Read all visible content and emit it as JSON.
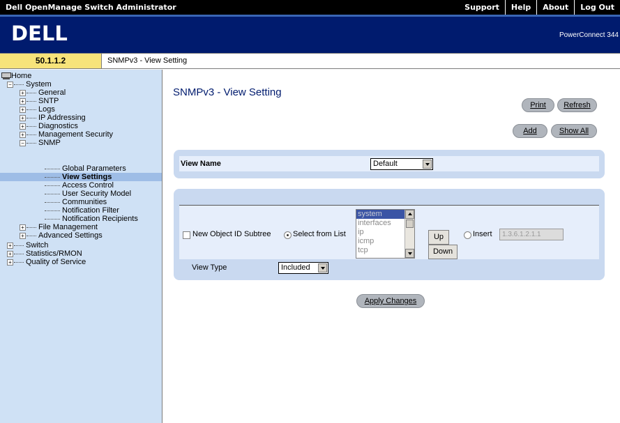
{
  "topbar": {
    "app_title": "Dell OpenManage Switch Administrator",
    "links": [
      "Support",
      "Help",
      "About",
      "Log Out"
    ]
  },
  "banner": {
    "logo_text": "DELL",
    "product": "PowerConnect 344"
  },
  "address": {
    "ip": "50.1.1.2",
    "breadcrumb": "SNMPv3 - View Setting"
  },
  "tree": {
    "home": "Home",
    "system": "System",
    "general": "General",
    "sntp": "SNTP",
    "logs": "Logs",
    "ip_addressing": "IP Addressing",
    "diagnostics": "Diagnostics",
    "mgmt_security": "Management Security",
    "snmp": "SNMP",
    "global_parameters": "Global Parameters",
    "view_settings": "View Settings",
    "access_control": "Access Control",
    "user_security_model": "User Security Model",
    "communities": "Communities",
    "notification_filter": "Notification Filter",
    "notification_recipients": "Notification Recipients",
    "file_management": "File Management",
    "advanced_settings": "Advanced Settings",
    "switch": "Switch",
    "statistics_rmon": "Statistics/RMON",
    "qos": "Quality of Service"
  },
  "main": {
    "title": "SNMPv3 - View Setting",
    "print": "Print",
    "refresh": "Refresh",
    "add": "Add",
    "show_all": "Show All",
    "view_name_label": "View Name",
    "view_name_value": "Default",
    "new_oid_label": "New Object ID Subtree",
    "select_from_list_label": "Select from List",
    "oid_list": [
      "system",
      "interfaces",
      "ip",
      "icmp",
      "tcp"
    ],
    "up": "Up",
    "down": "Down",
    "insert_label": "Insert",
    "insert_value": "1.3.6.1.2.1.1",
    "view_type_label": "View Type",
    "view_type_value": "Included",
    "apply": "Apply Changes"
  },
  "colors": {
    "banner": "#001b6e",
    "tree_bg": "#cfe1f5",
    "panel": "#c9d9f0",
    "ip_bg": "#f7e37a"
  }
}
